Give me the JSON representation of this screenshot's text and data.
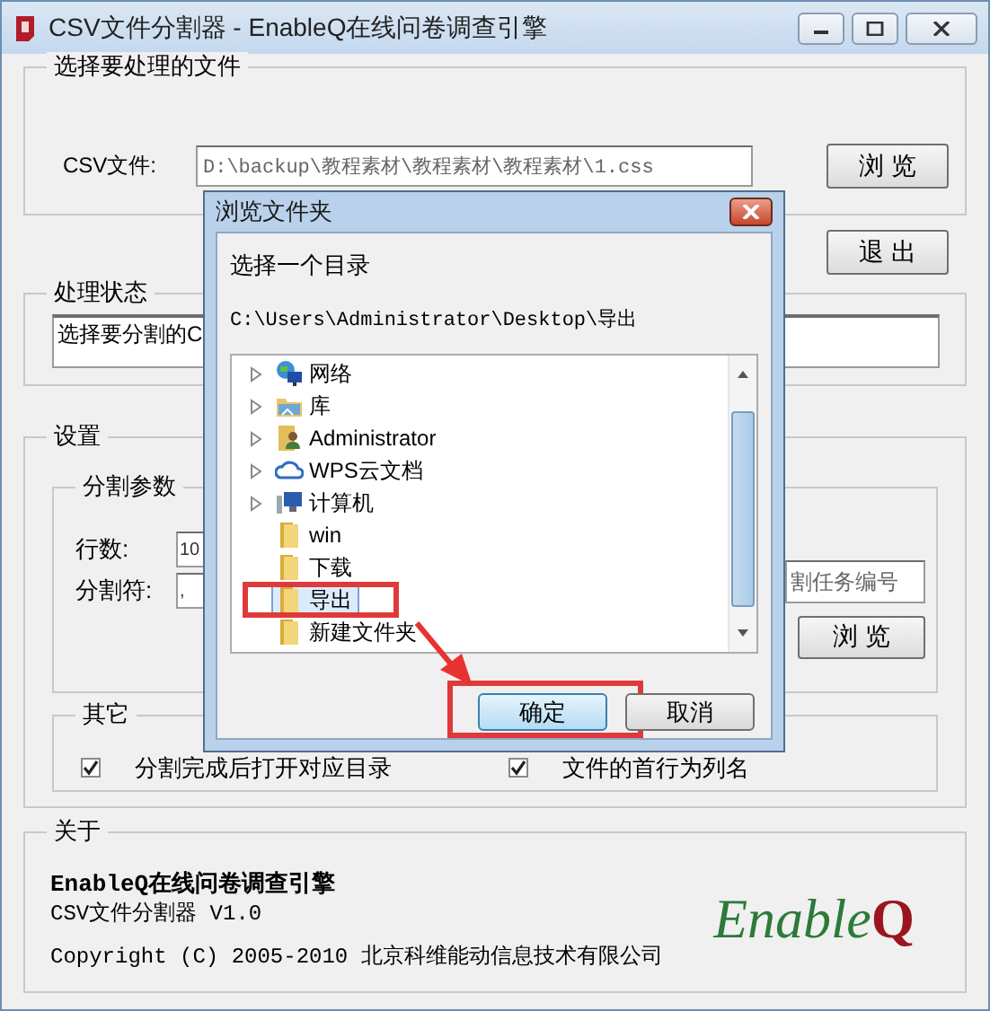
{
  "window": {
    "title": "CSV文件分割器 - EnableQ在线问卷调查引擎"
  },
  "file_group": {
    "title": "选择要处理的文件",
    "label": "CSV文件:",
    "value": "D:\\backup\\教程素材\\教程素材\\教程素材\\1.css",
    "browse": "浏 览"
  },
  "exit_button": "退 出",
  "status_group": {
    "title": "处理状态",
    "text": "选择要分割的C"
  },
  "settings": {
    "title": "设置",
    "params": {
      "title": "分割参数",
      "fields": [
        {
          "label": "行数:",
          "value": "10"
        },
        {
          "label": "分割符:",
          "value": ","
        }
      ],
      "task_field": {
        "placeholder": "割任务编号"
      },
      "browse": "浏 览"
    },
    "other": {
      "title": "其它",
      "options": [
        {
          "label": "分割完成后打开对应目录",
          "checked": true
        },
        {
          "label": "文件的首行为列名",
          "checked": true
        }
      ]
    }
  },
  "about": {
    "title": "关于",
    "product": "EnableQ在线问卷调查引擎",
    "version": "CSV文件分割器  V1.0",
    "copyright": "Copyright (C) 2005-2010 北京科维能动信息技术有限公司",
    "logo": {
      "text": "Enable",
      "mark": "Q"
    }
  },
  "dialog": {
    "title": "浏览文件夹",
    "prompt": "选择一个目录",
    "path": "C:\\Users\\Administrator\\Desktop\\导出",
    "arrow": true,
    "tree": [
      {
        "label": "网络",
        "kind": "network",
        "expandable": true,
        "selected": false,
        "highlighted": false
      },
      {
        "label": "库",
        "kind": "library",
        "expandable": true,
        "selected": false,
        "highlighted": false
      },
      {
        "label": "Administrator",
        "kind": "user",
        "expandable": true,
        "selected": false,
        "highlighted": false
      },
      {
        "label": "WPS云文档",
        "kind": "cloud",
        "expandable": true,
        "selected": false,
        "highlighted": false
      },
      {
        "label": "计算机",
        "kind": "computer",
        "expandable": true,
        "selected": false,
        "highlighted": false
      },
      {
        "label": "win",
        "kind": "folder",
        "expandable": false,
        "selected": false,
        "highlighted": false
      },
      {
        "label": "下载",
        "kind": "folder",
        "expandable": false,
        "selected": false,
        "highlighted": false
      },
      {
        "label": "导出",
        "kind": "folder",
        "expandable": false,
        "selected": true,
        "highlighted": true
      },
      {
        "label": "新建文件夹",
        "kind": "folder",
        "expandable": false,
        "selected": false,
        "highlighted": false
      }
    ],
    "buttons": [
      {
        "label": "确定",
        "default": true,
        "highlighted": true
      },
      {
        "label": "取消",
        "default": false,
        "highlighted": false
      }
    ]
  }
}
